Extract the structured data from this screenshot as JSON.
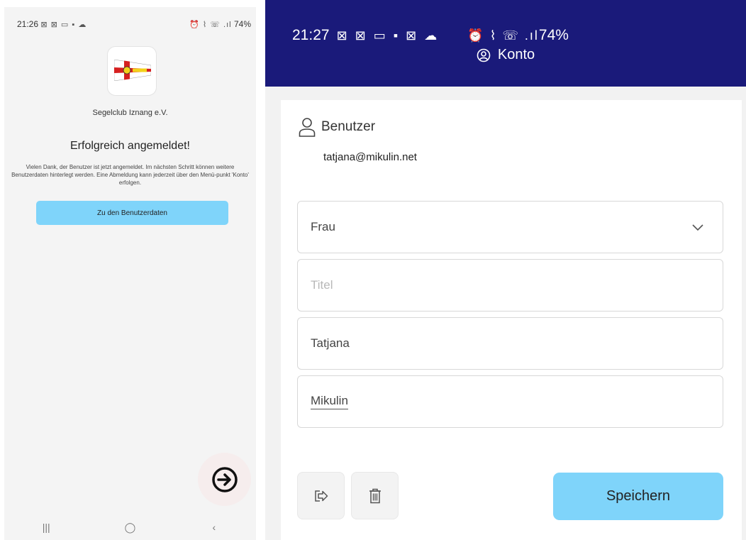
{
  "left_screen": {
    "status_bar": {
      "time": "21:26",
      "notif_icons": "⊠ ⊠ ▭ ▪ ☁",
      "right_icons": "⏰ ⌇ ☏ .ıl",
      "battery": "74%"
    },
    "club_name": "Segelclub Iznang e.V.",
    "title": "Erfolgreich angemeldet!",
    "message": "Vielen Dank, der Benutzer ist jetzt angemeldet. Im nächsten Schritt können weitere Benutzerdaten hinterlegt werden. Eine Abmeldung kann jederzeit über den Menü-punkt 'Konto' erfolgen.",
    "userdata_button": "Zu den Benutzerdaten",
    "nav": {
      "recents": "|||",
      "home": "◯",
      "back": "‹"
    }
  },
  "right_screen": {
    "status_bar": {
      "time": "21:27",
      "notif_icons": "⊠ ⊠ ▭ ▪ ⊠ ☁",
      "right_icons": "⏰ ⌇ ☏ .ıl",
      "battery": "74%"
    },
    "appbar_title": "Konto",
    "section_title": "Benutzer",
    "email": "tatjana@mikulin.net",
    "salutation": "Frau",
    "title_placeholder": "Titel",
    "first_name": "Tatjana",
    "last_name": "Mikulin",
    "save_button": "Speichern"
  },
  "colors": {
    "appbar": "#1a1a7a",
    "accent_button": "#7fd4fa",
    "burgee_red": "#d62020"
  }
}
